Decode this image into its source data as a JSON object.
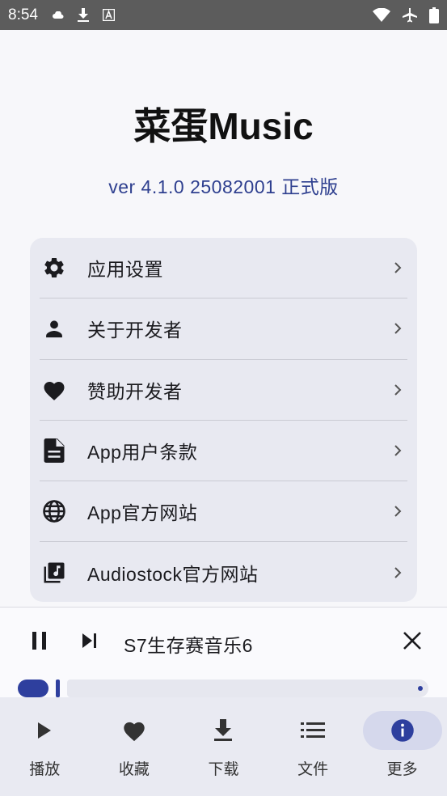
{
  "status_bar": {
    "time": "8:54"
  },
  "app": {
    "title": "菜蛋Music",
    "version": "ver 4.1.0 25082001 正式版"
  },
  "menu": {
    "items": [
      {
        "label": "应用设置",
        "icon": "gear-icon"
      },
      {
        "label": "关于开发者",
        "icon": "person-icon"
      },
      {
        "label": "赞助开发者",
        "icon": "heart-icon"
      },
      {
        "label": "App用户条款",
        "icon": "document-icon"
      },
      {
        "label": "App官方网站",
        "icon": "globe-icon"
      },
      {
        "label": "Audiostock官方网站",
        "icon": "music-library-icon"
      }
    ]
  },
  "player": {
    "track_title": "S7生存赛音乐6",
    "progress": 0.05
  },
  "bottom_nav": {
    "items": [
      {
        "label": "播放",
        "icon": "play-icon"
      },
      {
        "label": "收藏",
        "icon": "heart-icon"
      },
      {
        "label": "下载",
        "icon": "download-icon"
      },
      {
        "label": "文件",
        "icon": "list-icon"
      },
      {
        "label": "更多",
        "icon": "info-icon",
        "active": true
      }
    ]
  },
  "colors": {
    "accent": "#2e3f9e",
    "card": "#e8e9f1",
    "status_bar": "#5c5c5c"
  }
}
